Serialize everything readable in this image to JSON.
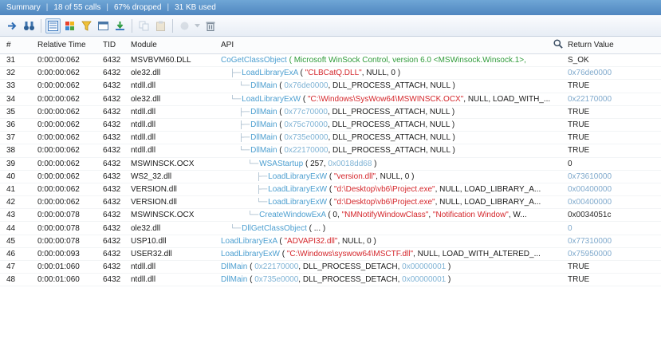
{
  "summary": {
    "label": "Summary",
    "calls": "18 of 55 calls",
    "dropped": "67% dropped",
    "used": "31 KB used"
  },
  "toolbar": {
    "icons": [
      "arrow-right-icon",
      "binoculars-icon",
      "view-grid-icon",
      "color-blocks-icon",
      "filter-icon",
      "window-icon",
      "import-icon",
      "copy-icon",
      "paste-icon",
      "record-icon",
      "dropdown-arrow-icon",
      "trash-icon"
    ]
  },
  "columns": {
    "num": "#",
    "time": "Relative Time",
    "tid": "TID",
    "module": "Module",
    "api": "API",
    "ret": "Return Value"
  },
  "rows": [
    {
      "num": "31",
      "time": "0:00:00:062",
      "tid": "6432",
      "module": "MSVBVM60.DLL",
      "indent": 0,
      "mark": "",
      "fn": "CoGetClassObject",
      "args": [
        {
          "t": "g",
          "v": " ( Microsoft WinSock Control, version 6.0 <MSWinsock.Winsock.1>, "
        }
      ],
      "ret": "S_OK",
      "ret_style": "plain"
    },
    {
      "num": "32",
      "time": "0:00:00:062",
      "tid": "6432",
      "module": "ole32.dll",
      "indent": 1,
      "mark": "├─",
      "fn": "LoadLibraryExA",
      "args": [
        {
          "t": "p",
          "v": " ( "
        },
        {
          "t": "s",
          "v": "\"CLBCatQ.DLL\""
        },
        {
          "t": "p",
          "v": ", NULL, 0 )"
        }
      ],
      "ret": "0x76de0000",
      "ret_style": "hex"
    },
    {
      "num": "33",
      "time": "0:00:00:062",
      "tid": "6432",
      "module": "ntdll.dll",
      "indent": 2,
      "mark": "└─",
      "fn": "DllMain",
      "args": [
        {
          "t": "p",
          "v": " ( "
        },
        {
          "t": "h",
          "v": "0x76de0000"
        },
        {
          "t": "p",
          "v": ", DLL_PROCESS_ATTACH, NULL )"
        }
      ],
      "ret": "TRUE",
      "ret_style": "plain"
    },
    {
      "num": "34",
      "time": "0:00:00:062",
      "tid": "6432",
      "module": "ole32.dll",
      "indent": 1,
      "mark": "└─",
      "fn": "LoadLibraryExW",
      "args": [
        {
          "t": "p",
          "v": " ( "
        },
        {
          "t": "s",
          "v": "\"C:\\Windows\\SysWow64\\MSWINSCK.OCX\""
        },
        {
          "t": "p",
          "v": ", NULL, LOAD_WITH_..."
        }
      ],
      "ret": "0x22170000",
      "ret_style": "hex"
    },
    {
      "num": "35",
      "time": "0:00:00:062",
      "tid": "6432",
      "module": "ntdll.dll",
      "indent": 2,
      "mark": "├─",
      "fn": "DllMain",
      "args": [
        {
          "t": "p",
          "v": " ( "
        },
        {
          "t": "h",
          "v": "0x77c70000"
        },
        {
          "t": "p",
          "v": ", DLL_PROCESS_ATTACH, NULL )"
        }
      ],
      "ret": "TRUE",
      "ret_style": "plain"
    },
    {
      "num": "36",
      "time": "0:00:00:062",
      "tid": "6432",
      "module": "ntdll.dll",
      "indent": 2,
      "mark": "├─",
      "fn": "DllMain",
      "args": [
        {
          "t": "p",
          "v": " ( "
        },
        {
          "t": "h",
          "v": "0x75c70000"
        },
        {
          "t": "p",
          "v": ", DLL_PROCESS_ATTACH, NULL )"
        }
      ],
      "ret": "TRUE",
      "ret_style": "plain"
    },
    {
      "num": "37",
      "time": "0:00:00:062",
      "tid": "6432",
      "module": "ntdll.dll",
      "indent": 2,
      "mark": "├─",
      "fn": "DllMain",
      "args": [
        {
          "t": "p",
          "v": " ( "
        },
        {
          "t": "h",
          "v": "0x735e0000"
        },
        {
          "t": "p",
          "v": ", DLL_PROCESS_ATTACH, NULL )"
        }
      ],
      "ret": "TRUE",
      "ret_style": "plain"
    },
    {
      "num": "38",
      "time": "0:00:00:062",
      "tid": "6432",
      "module": "ntdll.dll",
      "indent": 2,
      "mark": "└─",
      "fn": "DllMain",
      "args": [
        {
          "t": "p",
          "v": " ( "
        },
        {
          "t": "h",
          "v": "0x22170000"
        },
        {
          "t": "p",
          "v": ", DLL_PROCESS_ATTACH, NULL )"
        }
      ],
      "ret": "TRUE",
      "ret_style": "plain"
    },
    {
      "num": "39",
      "time": "0:00:00:062",
      "tid": "6432",
      "module": "MSWINSCK.OCX",
      "indent": 3,
      "mark": "└─",
      "fn": "WSAStartup",
      "args": [
        {
          "t": "p",
          "v": " ( 257, "
        },
        {
          "t": "h",
          "v": "0x0018dd68"
        },
        {
          "t": "p",
          "v": " )"
        }
      ],
      "ret": "0",
      "ret_style": "plain"
    },
    {
      "num": "40",
      "time": "0:00:00:062",
      "tid": "6432",
      "module": "WS2_32.dll",
      "indent": 4,
      "mark": "├─",
      "fn": "LoadLibraryExW",
      "args": [
        {
          "t": "p",
          "v": " ( "
        },
        {
          "t": "s",
          "v": "\"version.dll\""
        },
        {
          "t": "p",
          "v": ", NULL, 0 )"
        }
      ],
      "ret": "0x73610000",
      "ret_style": "hex"
    },
    {
      "num": "41",
      "time": "0:00:00:062",
      "tid": "6432",
      "module": "VERSION.dll",
      "indent": 4,
      "mark": "├─",
      "fn": "LoadLibraryExW",
      "args": [
        {
          "t": "p",
          "v": " ( "
        },
        {
          "t": "s",
          "v": "\"d:\\Desktop\\vb6\\Project.exe\""
        },
        {
          "t": "p",
          "v": ", NULL, LOAD_LIBRARY_A..."
        }
      ],
      "ret": "0x00400000",
      "ret_style": "hex"
    },
    {
      "num": "42",
      "time": "0:00:00:062",
      "tid": "6432",
      "module": "VERSION.dll",
      "indent": 4,
      "mark": "└─",
      "fn": "LoadLibraryExW",
      "args": [
        {
          "t": "p",
          "v": " ( "
        },
        {
          "t": "s",
          "v": "\"d:\\Desktop\\vb6\\Project.exe\""
        },
        {
          "t": "p",
          "v": ", NULL, LOAD_LIBRARY_A..."
        }
      ],
      "ret": "0x00400000",
      "ret_style": "hex"
    },
    {
      "num": "43",
      "time": "0:00:00:078",
      "tid": "6432",
      "module": "MSWINSCK.OCX",
      "indent": 3,
      "mark": "└─",
      "fn": "CreateWindowExA",
      "args": [
        {
          "t": "p",
          "v": " ( 0, "
        },
        {
          "t": "s",
          "v": "\"NMNotifyWindowClass\""
        },
        {
          "t": "p",
          "v": ", "
        },
        {
          "t": "s",
          "v": "\"Notification Window\""
        },
        {
          "t": "p",
          "v": ", W..."
        }
      ],
      "ret": "0x0034051c",
      "ret_style": "hex2"
    },
    {
      "num": "44",
      "time": "0:00:00:078",
      "tid": "6432",
      "module": "ole32.dll",
      "indent": 1,
      "mark": "└─",
      "fn": "DllGetClassObject",
      "args": [
        {
          "t": "p",
          "v": " ( ... )"
        }
      ],
      "ret": "0",
      "ret_style": "hex"
    },
    {
      "num": "45",
      "time": "0:00:00:078",
      "tid": "6432",
      "module": "USP10.dll",
      "indent": 0,
      "mark": "",
      "fn": "LoadLibraryExA",
      "args": [
        {
          "t": "p",
          "v": " ( "
        },
        {
          "t": "s",
          "v": "\"ADVAPI32.dll\""
        },
        {
          "t": "p",
          "v": ", NULL, 0 )"
        }
      ],
      "ret": "0x77310000",
      "ret_style": "hex"
    },
    {
      "num": "46",
      "time": "0:00:00:093",
      "tid": "6432",
      "module": "USER32.dll",
      "indent": 0,
      "mark": "",
      "fn": "LoadLibraryExW",
      "args": [
        {
          "t": "p",
          "v": " ( "
        },
        {
          "t": "s",
          "v": "\"C:\\Windows\\syswow64\\MSCTF.dll\""
        },
        {
          "t": "p",
          "v": ", NULL, LOAD_WITH_ALTERED_..."
        }
      ],
      "ret": "0x75950000",
      "ret_style": "hex"
    },
    {
      "num": "47",
      "time": "0:00:01:060",
      "tid": "6432",
      "module": "ntdll.dll",
      "indent": 0,
      "mark": "",
      "fn": "DllMain",
      "args": [
        {
          "t": "p",
          "v": " ( "
        },
        {
          "t": "h",
          "v": "0x22170000"
        },
        {
          "t": "p",
          "v": ", DLL_PROCESS_DETACH, "
        },
        {
          "t": "h",
          "v": "0x00000001"
        },
        {
          "t": "p",
          "v": " )"
        }
      ],
      "ret": "TRUE",
      "ret_style": "plain"
    },
    {
      "num": "48",
      "time": "0:00:01:060",
      "tid": "6432",
      "module": "ntdll.dll",
      "indent": 0,
      "mark": "",
      "fn": "DllMain",
      "args": [
        {
          "t": "p",
          "v": " ( "
        },
        {
          "t": "h",
          "v": "0x735e0000"
        },
        {
          "t": "p",
          "v": ", DLL_PROCESS_DETACH, "
        },
        {
          "t": "h",
          "v": "0x00000001"
        },
        {
          "t": "p",
          "v": " )"
        }
      ],
      "ret": "TRUE",
      "ret_style": "plain"
    }
  ]
}
